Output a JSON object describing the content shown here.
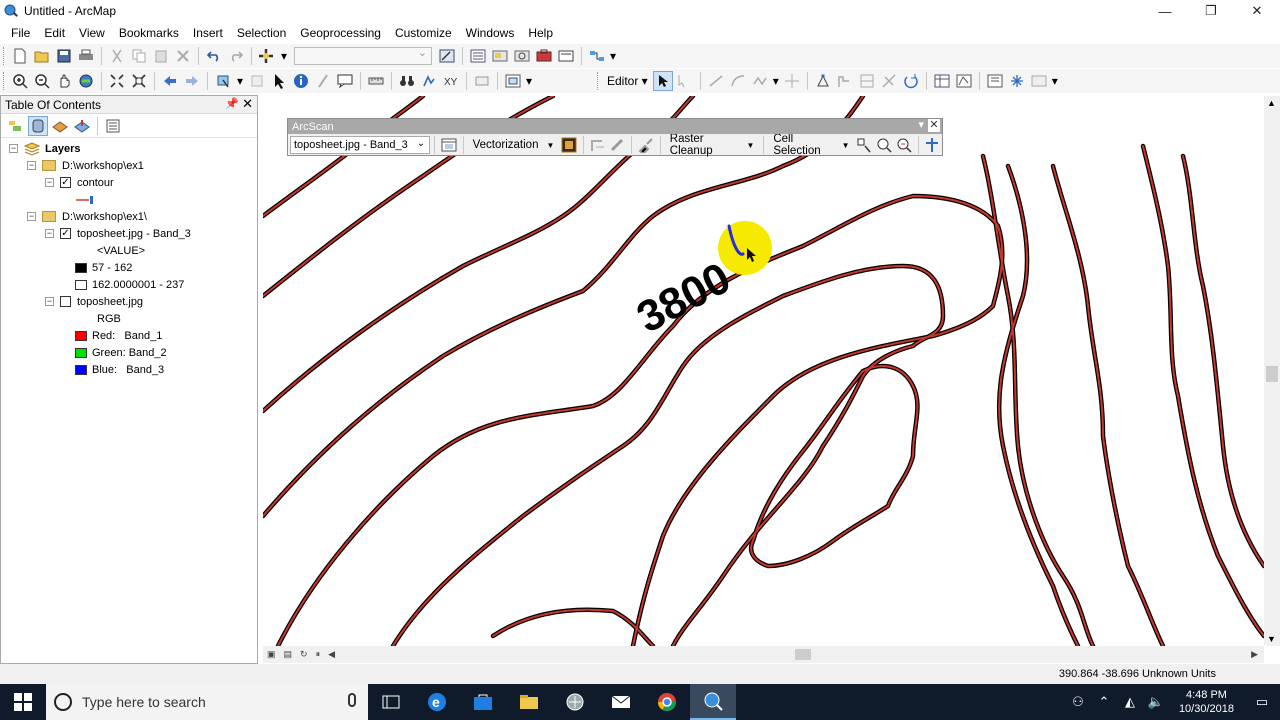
{
  "window": {
    "title": "Untitled - ArcMap"
  },
  "menu": [
    "File",
    "Edit",
    "View",
    "Bookmarks",
    "Insert",
    "Selection",
    "Geoprocessing",
    "Customize",
    "Windows",
    "Help"
  ],
  "toolbar": {
    "editor_label": "Editor ▾"
  },
  "toc": {
    "title": "Table Of Contents",
    "root_label": "Layers",
    "group1": "D:\\workshop\\ex1",
    "layer_contour": "contour",
    "group2": "D:\\workshop\\ex1\\",
    "layer_band3": "toposheet.jpg - Band_3",
    "value_label": "<VALUE>",
    "class1": "57 - 162",
    "class2": "162.0000001 - 237",
    "layer_topo": "toposheet.jpg",
    "rgb_label": "RGB",
    "red": "Red:",
    "red_band": "Band_1",
    "green": "Green:",
    "green_band": "Band_2",
    "blue": "Blue:",
    "blue_band": "Band_3"
  },
  "arcscan": {
    "title": "ArcScan",
    "raster": "toposheet.jpg - Band_3",
    "vectorization": "Vectorization",
    "raster_cleanup": "Raster Cleanup",
    "cell_selection": "Cell Selection"
  },
  "map": {
    "contour_label": "3800"
  },
  "status": {
    "coords": "390.864  -38.696 Unknown Units"
  },
  "taskbar": {
    "search_placeholder": "Type here to search",
    "time": "4:48 PM",
    "date": "10/30/2018"
  },
  "colors": {
    "contour_vector": "#c8372d",
    "raster_black": "#000000",
    "highlight": "#f6ea00",
    "taskbar": "#0f1b2b"
  }
}
